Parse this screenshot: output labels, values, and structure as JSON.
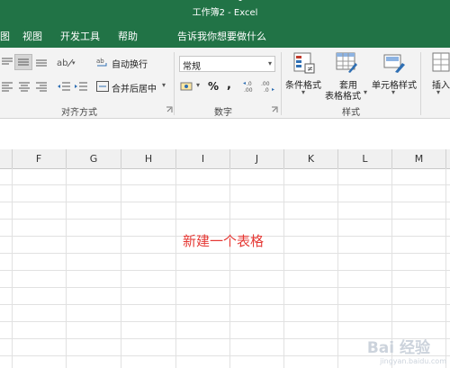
{
  "window": {
    "title": "工作簿2 - Excel"
  },
  "tabs": [
    {
      "label": "图"
    },
    {
      "label": "视图"
    },
    {
      "label": "开发工具"
    },
    {
      "label": "帮助"
    },
    {
      "label": "告诉我你想要做什么"
    }
  ],
  "ribbon": {
    "alignment": {
      "wrap_text": "自动换行",
      "merge_center": "合并后居中",
      "group_label": "对齐方式"
    },
    "number": {
      "format_value": "常规",
      "percent": "%",
      "comma": ",",
      "inc_decimal": "←.0 .00",
      "dec_decimal": ".00 →.0",
      "group_label": "数字"
    },
    "styles": {
      "conditional_format": "条件格式",
      "format_table_line1": "套用",
      "format_table_line2": "表格格式",
      "cell_styles": "单元格样式",
      "group_label": "样式"
    },
    "cells": {
      "insert": "插入"
    }
  },
  "columns": [
    "F",
    "G",
    "H",
    "I",
    "J",
    "K",
    "L",
    "M"
  ],
  "sheet": {
    "note": "新建一个表格"
  },
  "watermark": {
    "brand": "Bai 经验",
    "url": "jingyan.baidu.com"
  },
  "colors": {
    "accent": "#217346",
    "note": "#e53935"
  }
}
